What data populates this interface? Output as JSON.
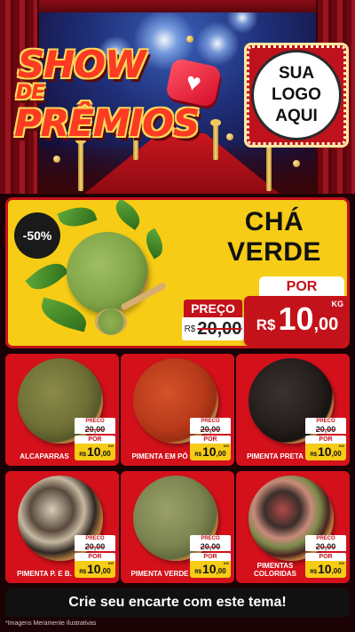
{
  "header": {
    "title_line1": "SHOW",
    "title_line2": "DE",
    "title_line3": "PRÊMIOS",
    "logo_placeholder": [
      "SUA",
      "LOGO",
      "AQUI"
    ]
  },
  "featured": {
    "discount": "-50%",
    "name_line1": "CHÁ",
    "name_line2": "VERDE",
    "por_label": "POR",
    "preco_label": "PREÇO",
    "old_currency": "R$",
    "old_price": "20,00",
    "currency": "R$",
    "price_int": "10",
    "price_dec": ",00",
    "unit": "KG"
  },
  "products": [
    {
      "name": "ALCAPARRAS",
      "preco_label": "PRECO",
      "old_price": "20,00",
      "por_label": "POR",
      "currency": "R$",
      "price_int": "10",
      "price_dec": ",00",
      "unit": "KG"
    },
    {
      "name": "PIMENTA EM PÓ",
      "preco_label": "PRECO",
      "old_price": "20,00",
      "por_label": "POR",
      "currency": "R$",
      "price_int": "10",
      "price_dec": ",00",
      "unit": "KG"
    },
    {
      "name": "PIMENTA PRETA",
      "preco_label": "PRECO",
      "old_price": "20,00",
      "por_label": "POR",
      "currency": "R$",
      "price_int": "10",
      "price_dec": ",00",
      "unit": "KG"
    },
    {
      "name": "PIMENTA P. E B.",
      "preco_label": "PRECO",
      "old_price": "20,00",
      "por_label": "POR",
      "currency": "R$",
      "price_int": "10",
      "price_dec": ",00",
      "unit": "KG"
    },
    {
      "name": "PIMENTA VERDE",
      "preco_label": "PRECO",
      "old_price": "20,00",
      "por_label": "POR",
      "currency": "R$",
      "price_int": "10",
      "price_dec": ",00",
      "unit": "KG"
    },
    {
      "name": "PIMENTAS COLORIDAS",
      "preco_label": "PRECO",
      "old_price": "20,00",
      "por_label": "POR",
      "currency": "R$",
      "price_int": "10",
      "price_dec": ",00",
      "unit": "KG"
    }
  ],
  "footer": {
    "cta": "Crie seu encarte com este tema!",
    "disclaimer": "*Imagens Meramente Ilustrativas"
  },
  "colors": {
    "red": "#c4121a",
    "card_red": "#d4111b",
    "yellow": "#f6cc16",
    "dark": "#111111"
  }
}
